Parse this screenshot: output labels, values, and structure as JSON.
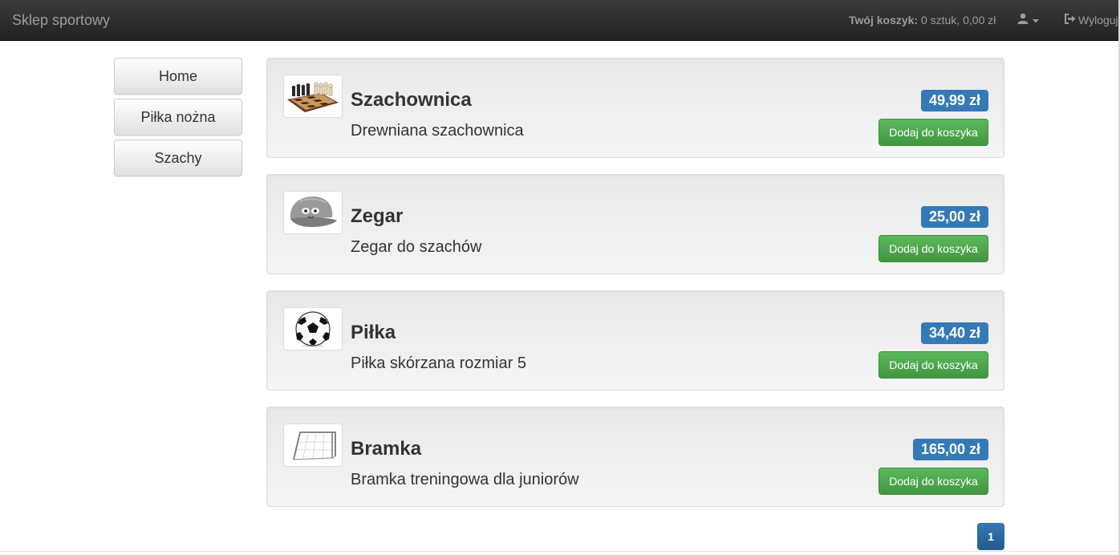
{
  "navbar": {
    "brand": "Sklep sportowy",
    "cart_label": "Twój koszyk:",
    "cart_summary": "0 sztuk, 0,00 zł",
    "user_icon": "user-icon",
    "logout_icon": "logout-icon",
    "logout_label": "Wyloguj"
  },
  "sidebar": {
    "items": [
      {
        "label": "Home"
      },
      {
        "label": "Piłka nożna"
      },
      {
        "label": "Szachy"
      }
    ]
  },
  "products": [
    {
      "name": "Szachownica",
      "description": "Drewniana szachownica",
      "price": "49,99 zł",
      "button": "Dodaj do koszyka",
      "image": "chessboard-image"
    },
    {
      "name": "Zegar",
      "description": "Zegar do szachów",
      "price": "25,00 zł",
      "button": "Dodaj do koszyka",
      "image": "cap-image"
    },
    {
      "name": "Piłka",
      "description": "Piłka skórzana rozmiar 5",
      "price": "34,40 zł",
      "button": "Dodaj do koszyka",
      "image": "soccer-ball-image"
    },
    {
      "name": "Bramka",
      "description": "Bramka treningowa dla juniorów",
      "price": "165,00 zł",
      "button": "Dodaj do koszyka",
      "image": "goal-image"
    }
  ],
  "pagination": {
    "current_page": "1"
  },
  "colors": {
    "navbar": "#222222",
    "primary": "#337ab7",
    "success": "#5cb85c"
  }
}
